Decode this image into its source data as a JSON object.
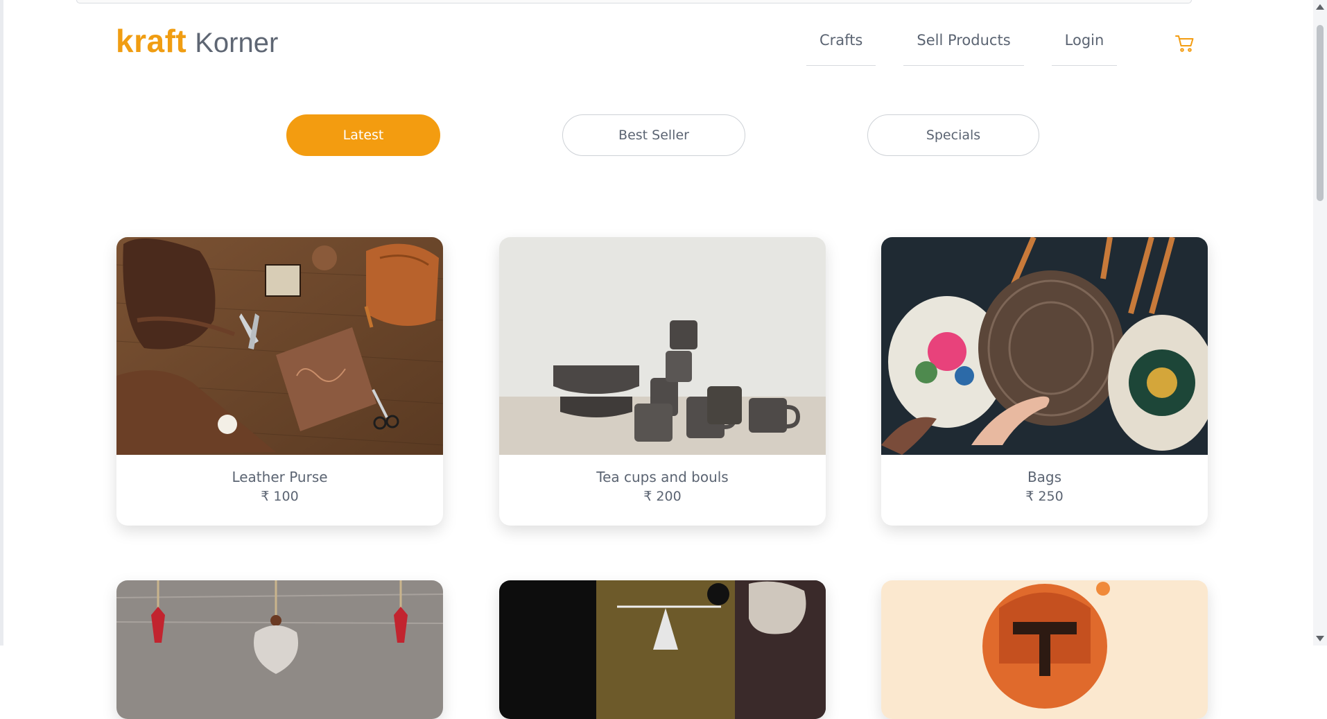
{
  "brand": {
    "bold": "kraft",
    "light": "Korner"
  },
  "nav": {
    "items": [
      {
        "label": "Crafts"
      },
      {
        "label": "Sell Products"
      },
      {
        "label": "Login"
      }
    ],
    "cart_icon": "cart-icon"
  },
  "tabs": [
    {
      "label": "Latest",
      "active": true
    },
    {
      "label": "Best Seller",
      "active": false
    },
    {
      "label": "Specials",
      "active": false
    }
  ],
  "products": [
    {
      "name": "Leather Purse",
      "price": "₹ 100"
    },
    {
      "name": "Tea cups and bouls",
      "price": "₹ 200"
    },
    {
      "name": "Bags",
      "price": "₹ 250"
    }
  ],
  "colors": {
    "accent": "#f39c10",
    "text": "#5b6472"
  }
}
